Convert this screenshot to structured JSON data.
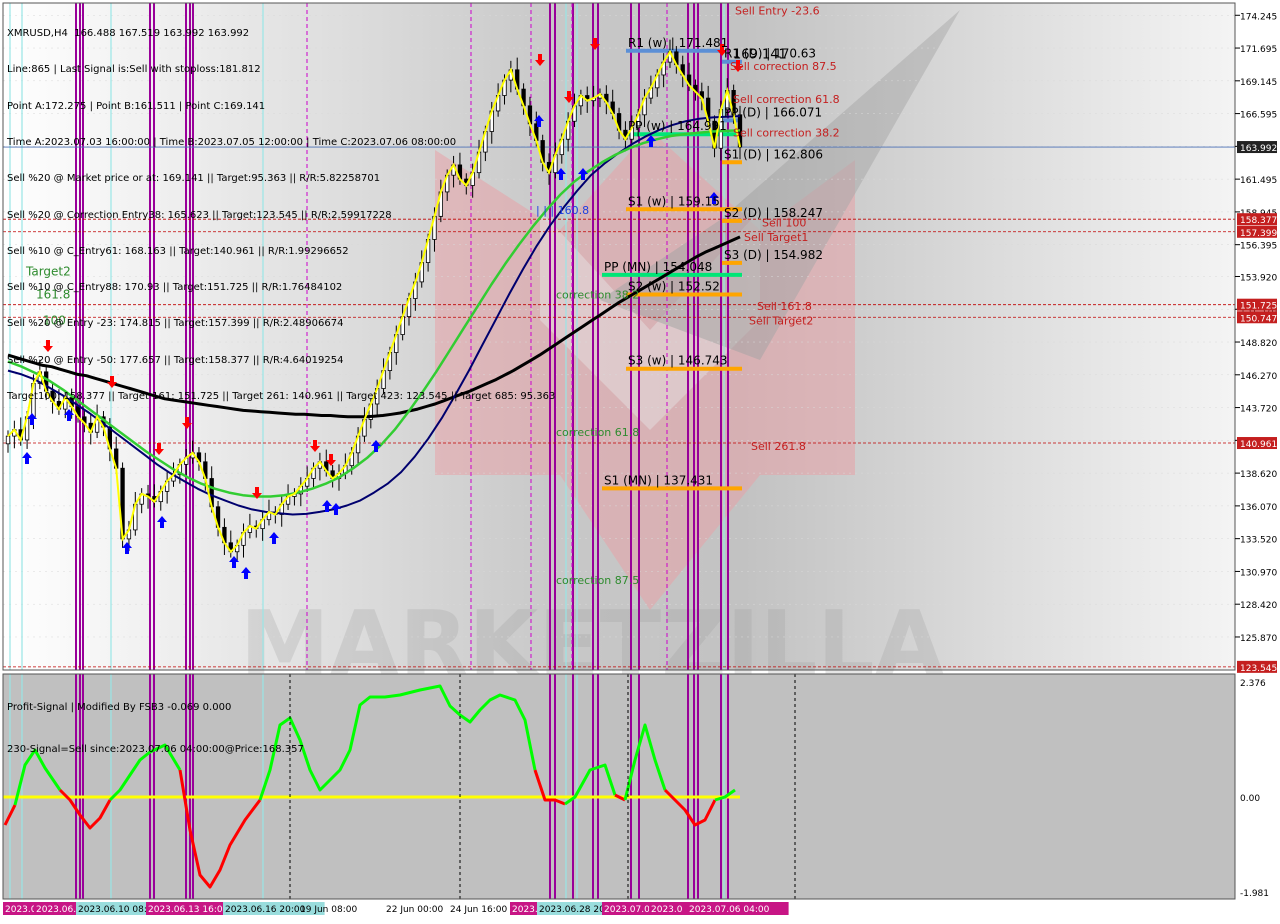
{
  "hud": {
    "lines": [
      "XMRUSD,H4  166.488 167.519 163.992 163.992",
      "Line:865 | Last Signal is:Sell with stoploss:181.812",
      "Point A:172.275 | Point B:161.511 | Point C:169.141",
      "Time A:2023.07.03 16:00:00 | Time B:2023.07.05 12:00:00 | Time C:2023.07.06 08:00:00",
      "Sell %20 @ Market price or at: 169.141 || Target:95.363 || R/R:5.82258701",
      "Sell %20 @ Correction Entry38: 165.623 || Target:123.545 || R/R:2.59917228",
      "Sell %10 @ C_Entry61: 168.163 || Target:140.961 || R/R:1.99296652",
      "Sell %10 @ C_Entry88: 170.93 || Target:151.725 || R/R:1.76484102",
      "Sell %20 @ Entry -23: 174.815 || Target:157.399 || R/R:2.48906674",
      "Sell %20 @ Entry -50: 177.657 || Target:158.377 || R/R:4.64019254",
      "Target100: 158.377 || Target 161: 151.725 || Target 261: 140.961 || Target 423: 123.545 || Target 685: 95.363"
    ]
  },
  "indicator": {
    "title": "Profit-Signal | Modified By FSB3 -0.069 0.000",
    "signal_text": "230-Signal=Sell since:2023.07.06 04:00:00@Price:168.357",
    "ticks": [
      "2.376",
      "0.00",
      "-1.981"
    ]
  },
  "colors": {
    "ma_black": "#000000",
    "ma_navy": "#00006e",
    "ma_green": "#32cd32",
    "price_yellow": "#ffff00",
    "candle": "#000000",
    "magenta_line": "#990099",
    "cyan_line": "#99e6e6",
    "dashed_red": "#c00000",
    "level_orange": "#ffa500",
    "level_blue": "#5b8fd6",
    "level_green": "#00e676",
    "osc_green": "#00ff00",
    "osc_red": "#ff0000",
    "osc_zero": "#ffff00",
    "arrow_up": "#0000ff",
    "arrow_down": "#ff0000",
    "watermark": "#e8a3a8",
    "price_tag_red": "#c41f1f",
    "price_tag_dark": "#222222",
    "axis_bg": "#ffffff",
    "indicator_bg": "#c0c0c0"
  },
  "chart_data": {
    "type": "candlestick",
    "symbol": "XMRUSD",
    "timeframe": "H4",
    "ohlc_last": {
      "open": 166.488,
      "high": 167.519,
      "low": 163.992,
      "close": 163.992
    },
    "ylim": [
      123.3,
      175.2
    ],
    "y_ticks": [
      "174.245",
      "171.695",
      "169.145",
      "166.595",
      "164.045",
      "161.495",
      "158.945",
      "156.395",
      "153.920",
      "151.370",
      "148.820",
      "146.270",
      "143.720",
      "141.170",
      "138.620",
      "136.070",
      "133.520",
      "130.970",
      "128.420",
      "125.870"
    ],
    "current_price": "163.992",
    "price_tags": [
      {
        "label": "163.992",
        "value": 163.992,
        "kind": "current"
      },
      {
        "label": "158.377",
        "value": 158.377,
        "kind": "target"
      },
      {
        "label": "157.399",
        "value": 157.399,
        "kind": "target"
      },
      {
        "label": "151.725",
        "value": 151.725,
        "kind": "target"
      },
      {
        "label": "150.747",
        "value": 150.747,
        "kind": "target"
      },
      {
        "label": "140.961",
        "value": 140.961,
        "kind": "target"
      },
      {
        "label": "123.545",
        "value": 123.545,
        "kind": "target"
      }
    ],
    "x_ticks": [
      "2023.06.0",
      "2023.06.",
      "2023.06.10 08:00",
      "2023.06.13 16:00",
      "2023.06.16 20:00",
      "19 Jun 08:00",
      "22 Jun 00:00",
      "24 Jun 16:00",
      "2023.0",
      "2023.06.28 20",
      "2023.07.0",
      "2023.0",
      "2023.07.06 04:00"
    ],
    "close": [
      141.5,
      142.0,
      141.2,
      143.0,
      145.6,
      146.5,
      145.0,
      144.2,
      143.6,
      144.5,
      143.8,
      143.0,
      142.5,
      141.8,
      143.0,
      142.2,
      140.5,
      139.0,
      133.5,
      134.2,
      136.2,
      137.0,
      136.8,
      136.4,
      137.2,
      138.0,
      138.5,
      139.3,
      139.8,
      140.2,
      139.5,
      138.2,
      136.0,
      134.4,
      133.2,
      132.5,
      133.0,
      134.0,
      134.5,
      134.3,
      135.0,
      135.6,
      135.4,
      136.2,
      136.8,
      137.0,
      137.6,
      138.2,
      139.0,
      139.5,
      138.8,
      138.2,
      138.6,
      139.2,
      140.2,
      141.5,
      142.8,
      144.0,
      145.2,
      146.6,
      148.0,
      149.4,
      150.8,
      152.2,
      153.5,
      155.0,
      156.8,
      158.6,
      160.5,
      161.8,
      162.6,
      161.5,
      161.0,
      162.0,
      163.6,
      165.2,
      166.8,
      168.0,
      169.2,
      170.0,
      168.5,
      167.2,
      165.8,
      164.5,
      162.8,
      162.0,
      163.4,
      164.6,
      166.0,
      167.2,
      168.0,
      167.6,
      167.8,
      168.1,
      167.5,
      166.6,
      165.3,
      164.6,
      165.5,
      166.5,
      167.8,
      168.6,
      169.6,
      170.6,
      171.4,
      170.4,
      169.6,
      168.8,
      168.3,
      167.8,
      166.0,
      163.9,
      166.9,
      168.4,
      166.5,
      163.992
    ],
    "series": [
      {
        "name": "",
        "values": [
          147.8,
          147.6,
          147.4,
          147.2,
          147.0,
          146.9,
          146.7,
          146.5,
          146.3,
          146.2,
          146.0,
          145.8,
          145.6,
          145.4,
          145.2,
          145.0,
          144.8,
          144.6,
          144.4,
          144.3,
          144.2,
          144.1,
          144.0,
          143.9,
          143.8,
          143.7,
          143.6,
          143.5,
          143.45,
          143.4,
          143.35,
          143.3,
          143.25,
          143.2,
          143.2,
          143.15,
          143.1,
          143.1,
          143.05,
          143.0,
          143.0,
          143.0,
          143.05,
          143.1,
          143.2,
          143.3,
          143.45,
          143.6,
          143.8,
          144.0,
          144.25,
          144.5,
          144.75,
          145.0,
          145.3,
          145.6,
          145.9,
          146.25,
          146.6,
          147.0,
          147.4,
          147.8,
          148.25,
          148.7,
          149.15,
          149.6,
          150.05,
          150.5,
          150.95,
          151.4,
          151.85,
          152.25,
          152.65,
          153.05,
          153.45,
          153.85,
          154.25,
          154.65,
          155.05,
          155.45,
          155.8,
          156.1,
          156.4,
          156.7,
          157.0
        ]
      },
      {
        "name": "",
        "values": [
          146.6,
          146.3,
          145.9,
          145.3,
          144.7,
          144.0,
          143.3,
          142.5,
          141.7,
          140.9,
          140.1,
          139.3,
          138.6,
          138.0,
          137.4,
          136.9,
          136.5,
          136.1,
          135.8,
          135.6,
          135.5,
          135.4,
          135.45,
          135.6,
          135.8,
          136.1,
          136.5,
          137.1,
          137.8,
          138.7,
          139.9,
          141.3,
          142.9,
          144.7,
          146.6,
          148.6,
          150.6,
          152.6,
          154.5,
          156.3,
          157.9,
          159.3,
          160.6,
          161.8,
          162.7,
          163.5,
          164.2,
          164.8,
          165.3,
          165.7,
          166.0,
          166.2,
          166.3,
          166.35,
          166.4
        ]
      },
      {
        "name": "",
        "values": [
          147.3,
          146.9,
          146.4,
          145.8,
          145.1,
          144.3,
          143.5,
          142.7,
          141.9,
          141.1,
          140.3,
          139.6,
          138.9,
          138.3,
          137.8,
          137.4,
          137.1,
          136.9,
          136.8,
          136.8,
          136.9,
          137.1,
          137.4,
          137.8,
          138.3,
          139.0,
          139.8,
          140.8,
          142.0,
          143.4,
          144.9,
          146.5,
          148.2,
          149.9,
          151.6,
          153.3,
          154.9,
          156.4,
          157.8,
          159.1,
          160.3,
          161.3,
          162.1,
          162.8,
          163.4,
          163.9,
          164.3,
          164.6,
          164.85,
          165.0,
          165.1,
          165.2,
          165.25,
          165.3
        ]
      }
    ],
    "levels": [
      {
        "label": "R1 (w) | 171.481",
        "value": 171.481,
        "color": "blue"
      },
      {
        "label": "R1 (D) | 170.63",
        "value": 170.63,
        "color": "blue"
      },
      {
        "label": "PP (D) | 166.071",
        "value": 166.071,
        "color": "blue"
      },
      {
        "label": "PP (w) | 164.991",
        "value": 164.991,
        "color": "green"
      },
      {
        "label": "S1 (D) | 162.806",
        "value": 162.806,
        "color": "orange"
      },
      {
        "label": "S1 (w) | 159.15",
        "value": 159.15,
        "color": "orange"
      },
      {
        "label": "S2 (D) | 158.247",
        "value": 158.247,
        "color": "orange"
      },
      {
        "label": "S3 (D) | 154.982",
        "value": 154.982,
        "color": "orange"
      },
      {
        "label": "PP (MN) | 154.048",
        "value": 154.048,
        "color": "green"
      },
      {
        "label": "S2 (w) | 152.52",
        "value": 152.52,
        "color": "orange"
      },
      {
        "label": "S3 (w) | 146.743",
        "value": 146.743,
        "color": "orange"
      },
      {
        "label": "S1 (MN) | 137.431",
        "value": 137.431,
        "color": "orange"
      }
    ],
    "annotations": [
      {
        "text": "Target2",
        "value": 154.0,
        "color": "green"
      },
      {
        "text": "161.8",
        "value": 152.2,
        "color": "green"
      },
      {
        "text": "100",
        "value": 150.2,
        "color": "green"
      },
      {
        "text": "correction 38.2",
        "value": 152.2,
        "color": "green"
      },
      {
        "text": "correction 61.8",
        "value": 141.5,
        "color": "green"
      },
      {
        "text": "correction 87.5",
        "value": 130.0,
        "color": "green"
      },
      {
        "text": "Sell Entry -23.6",
        "value": 174.3,
        "color": "red"
      },
      {
        "text": "Sell correction 87.5",
        "value": 170.0,
        "color": "red"
      },
      {
        "text": "Sell correction 61.8",
        "value": 167.4,
        "color": "red"
      },
      {
        "text": "Sell correction 38.2",
        "value": 164.8,
        "color": "red"
      },
      {
        "text": "Sell 100",
        "value": 157.8,
        "color": "red"
      },
      {
        "text": "Sell Target1",
        "value": 156.7,
        "color": "red"
      },
      {
        "text": "Sell 161.8",
        "value": 151.3,
        "color": "red"
      },
      {
        "text": "Sell Target2",
        "value": 150.2,
        "color": "red"
      },
      {
        "text": "Sell 261.8",
        "value": 140.4,
        "color": "red"
      },
      {
        "text": "| | | 160.8",
        "value": 158.8,
        "color": "blue"
      },
      {
        "text": "169.141",
        "value": 170.9,
        "color": "black"
      }
    ]
  }
}
